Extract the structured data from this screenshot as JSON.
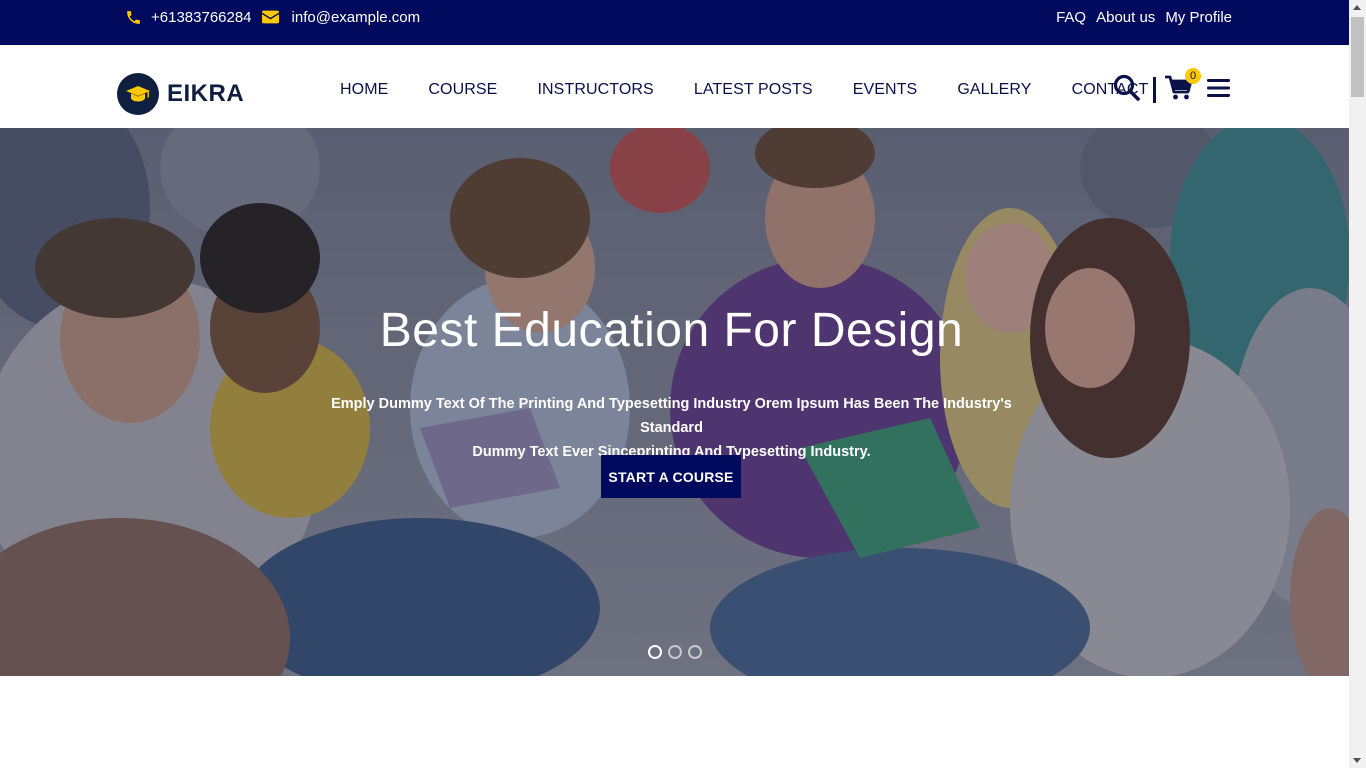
{
  "topbar": {
    "phone": "+61383766284",
    "email": "info@example.com",
    "links": [
      "FAQ",
      "About us",
      "My Profile"
    ]
  },
  "header": {
    "logo_text": "EIKRA",
    "nav": [
      "HOME",
      "COURSE",
      "INSTRUCTORS",
      "LATEST POSTS",
      "EVENTS",
      "GALLERY",
      "CONTACT"
    ],
    "cart_count": "0",
    "icons": [
      "search-icon",
      "cart-icon",
      "hamburger-icon"
    ]
  },
  "hero": {
    "title": "Best Education For Design",
    "text_line1": "Emply Dummy Text Of The Printing And Typesetting Industry Orem Ipsum Has Been The Industry's Standard",
    "text_line2": "Dummy Text Ever Sinceprinting And Typesetting Industry.",
    "button": "START A COURSE",
    "slide_count": 3,
    "active_slide": 1
  },
  "colors": {
    "primary": "#020a5e",
    "accent": "#fdc800",
    "nav_text": "#0a1149",
    "logo": "#0f1f3f"
  }
}
